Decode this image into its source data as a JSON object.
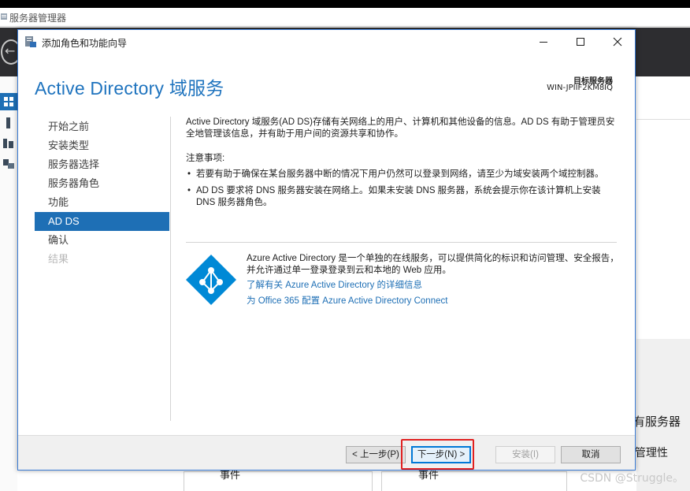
{
  "background": {
    "window_title": "服务器管理器",
    "right_panel_title": "有服务器",
    "right_panel_manage": "管理性",
    "tile_labels": [
      "事件",
      "事件"
    ],
    "watermark": "CSDN @Struggle。"
  },
  "dialog": {
    "title": "添加角色和功能向导",
    "page_title": "Active Directory 域服务",
    "target_label": "目标服务器",
    "target_value": "WIN-JPIIF2KM8IQ",
    "nav": [
      {
        "label": "开始之前",
        "state": "normal"
      },
      {
        "label": "安装类型",
        "state": "normal"
      },
      {
        "label": "服务器选择",
        "state": "normal"
      },
      {
        "label": "服务器角色",
        "state": "normal"
      },
      {
        "label": "功能",
        "state": "normal"
      },
      {
        "label": "AD DS",
        "state": "active"
      },
      {
        "label": "确认",
        "state": "normal"
      },
      {
        "label": "结果",
        "state": "disabled"
      }
    ],
    "content": {
      "intro": "Active Directory 域服务(AD DS)存储有关网络上的用户、计算机和其他设备的信息。AD DS 有助于管理员安全地管理该信息，并有助于用户间的资源共享和协作。",
      "notes_title": "注意事项:",
      "bullets": [
        "若要有助于确保在某台服务器中断的情况下用户仍然可以登录到网络，请至少为域安装两个域控制器。",
        "AD DS 要求将 DNS 服务器安装在网络上。如果未安装 DNS 服务器，系统会提示你在该计算机上安装 DNS 服务器角色。"
      ],
      "azure_text": "Azure Active Directory 是一个单独的在线服务，可以提供简化的标识和访问管理、安全报告，并允许通过单一登录登录到云和本地的 Web 应用。",
      "link_learn_more": "了解有关 Azure Active Directory 的详细信息",
      "link_configure": "为 Office 365 配置 Azure Active Directory Connect"
    },
    "buttons": {
      "prev": "< 上一步(P)",
      "next": "下一步(N) >",
      "install": "安装(I)",
      "cancel": "取消"
    }
  },
  "colors": {
    "accent": "#1e6fb5",
    "title_blue": "#1e73be",
    "highlight_red": "#e02020",
    "azure_blue": "#0089d6"
  }
}
